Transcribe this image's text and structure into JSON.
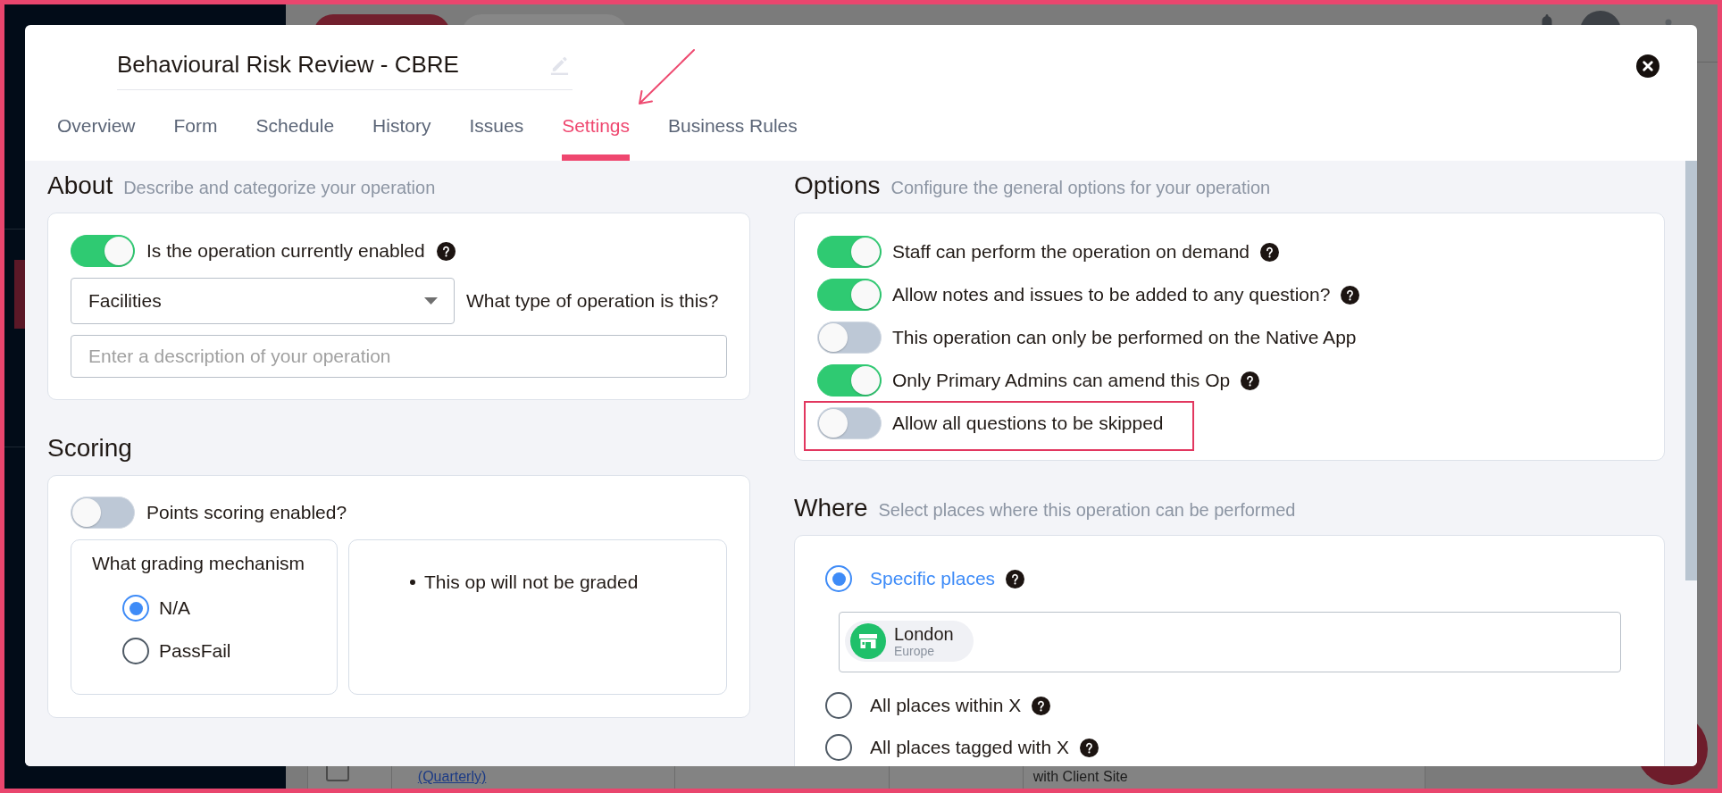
{
  "background": {
    "cells": [
      "(Quarterly)",
      "with Client Site"
    ]
  },
  "modal": {
    "title": "Behavioural Risk Review - CBRE"
  },
  "tabs": [
    {
      "label": "Overview",
      "selected": false
    },
    {
      "label": "Form",
      "selected": false
    },
    {
      "label": "Schedule",
      "selected": false
    },
    {
      "label": "History",
      "selected": false
    },
    {
      "label": "Issues",
      "selected": false
    },
    {
      "label": "Settings",
      "selected": true
    },
    {
      "label": "Business Rules",
      "selected": false
    }
  ],
  "about": {
    "heading": "About",
    "subtitle": "Describe and categorize your operation",
    "enabled": {
      "label": "Is the operation currently enabled",
      "on": true,
      "help": true
    },
    "type": {
      "value": "Facilities",
      "label": "What type of operation is this?"
    },
    "description": {
      "placeholder": "Enter a description of your operation"
    }
  },
  "scoring": {
    "heading": "Scoring",
    "points": {
      "label": "Points scoring enabled?",
      "on": false
    },
    "grading": {
      "label": "What grading mechanism",
      "options": [
        {
          "label": "N/A",
          "selected": true
        },
        {
          "label": "PassFail",
          "selected": false
        }
      ]
    },
    "notes": [
      "This op will not be graded"
    ]
  },
  "options": {
    "heading": "Options",
    "subtitle": "Configure the general options for your operation",
    "items": [
      {
        "label": "Staff can perform the operation on demand",
        "on": true,
        "help": true,
        "highlighted": false
      },
      {
        "label": "Allow notes and issues to be added to any question?",
        "on": true,
        "help": true,
        "highlighted": false
      },
      {
        "label": "This operation can only be performed on the Native App",
        "on": false,
        "help": false,
        "highlighted": false
      },
      {
        "label": "Only Primary Admins can amend this Op",
        "on": true,
        "help": true,
        "highlighted": false
      },
      {
        "label": "Allow all questions to be skipped",
        "on": false,
        "help": false,
        "highlighted": true
      }
    ]
  },
  "where": {
    "heading": "Where",
    "subtitle": "Select places where this operation can be performed",
    "choices": [
      {
        "label": "Specific places",
        "selected": true,
        "help": true,
        "places": [
          {
            "name": "London",
            "region": "Europe"
          }
        ]
      },
      {
        "label": "All places within X",
        "selected": false,
        "help": true
      },
      {
        "label": "All places tagged with X",
        "selected": false,
        "help": true
      }
    ]
  }
}
